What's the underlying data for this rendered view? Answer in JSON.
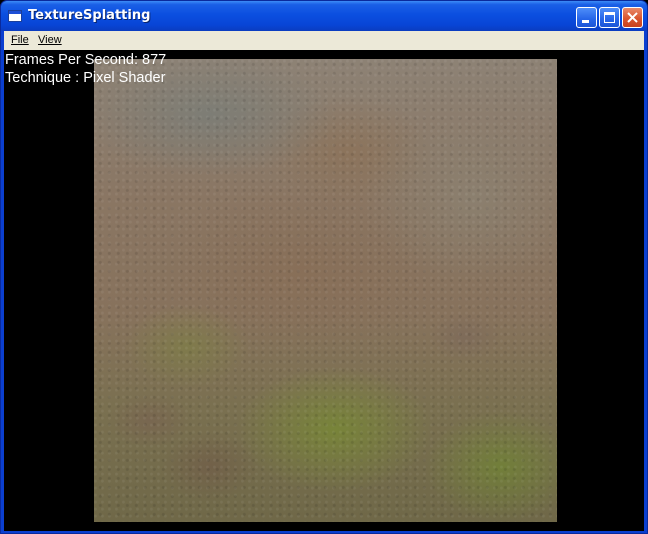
{
  "window": {
    "title": "TextureSplatting",
    "title_icon": "app-window-icon",
    "controls": [
      "minimize-icon",
      "maximize-icon",
      "close-icon"
    ]
  },
  "menubar": {
    "items": [
      {
        "label": "File"
      },
      {
        "label": "View"
      }
    ]
  },
  "overlay": {
    "fps_text": "Frames Per Second: 877",
    "technique_text": "Technique : Pixel Shader"
  },
  "colors": {
    "titlebar": "#0b4fe0",
    "menubar": "#ece9d8",
    "client_background": "#000000",
    "close_button": "#d9552f"
  }
}
